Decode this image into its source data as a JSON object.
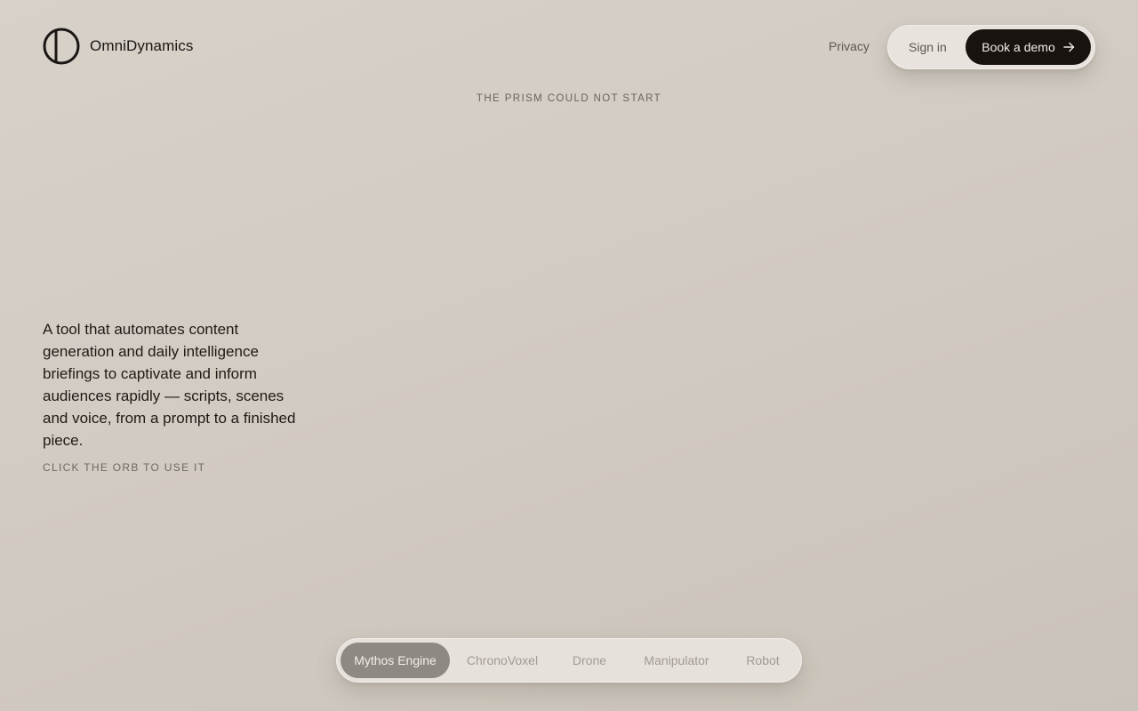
{
  "brand": {
    "name": "OmniDynamics"
  },
  "nav": {
    "privacy_label": "Privacy",
    "sign_in_label": "Sign in",
    "demo_label": "Book a demo",
    "demo_icon": "arrow-right-icon"
  },
  "status_message": "THE PRISM COULD NOT START",
  "hero": {
    "tagline": "A tool that automates content generation and daily intelligence briefings to captivate and inform audiences rapidly — scripts, scenes and voice, from a prompt to a finished piece.",
    "hint": "CLICK THE ORB TO USE IT"
  },
  "tabs": {
    "selected": "Mythos Engine",
    "items": [
      {
        "label": "Mythos Engine"
      },
      {
        "label": "ChronoVoxel"
      },
      {
        "label": "Drone"
      },
      {
        "label": "Manipulator"
      },
      {
        "label": "Robot"
      }
    ]
  },
  "colors": {
    "background": "#d2cbc2",
    "text": "#1a1613",
    "primary_button": "#18130f",
    "active_tab": "#8e8983",
    "pill_surface": "#e8e3dd"
  }
}
